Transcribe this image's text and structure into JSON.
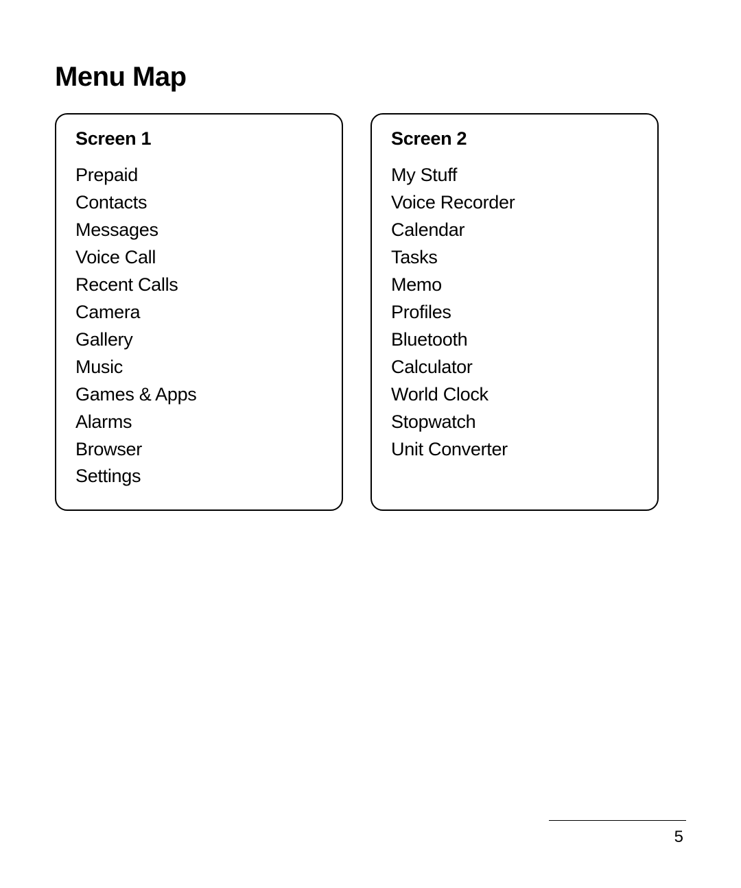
{
  "title": "Menu Map",
  "screens": [
    {
      "title": "Screen 1",
      "items": [
        "Prepaid",
        "Contacts",
        "Messages",
        "Voice Call",
        "Recent Calls",
        "Camera",
        "Gallery",
        "Music",
        "Games & Apps",
        "Alarms",
        "Browser",
        "Settings"
      ]
    },
    {
      "title": "Screen 2",
      "items": [
        "My Stuff",
        "Voice Recorder",
        "Calendar",
        "Tasks",
        "Memo",
        "Profiles",
        "Bluetooth",
        "Calculator",
        "World Clock",
        "Stopwatch",
        "Unit Converter"
      ]
    }
  ],
  "page_number": "5"
}
